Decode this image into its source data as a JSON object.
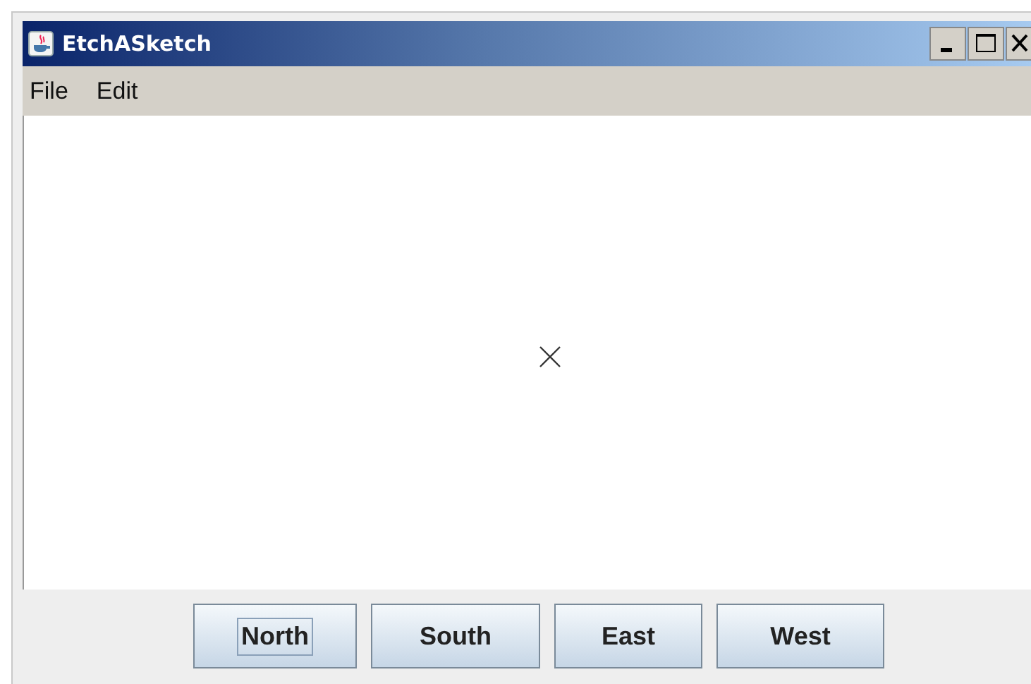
{
  "window": {
    "title": "EtchASketch"
  },
  "menu_bar": [
    "File",
    "Edit"
  ],
  "buttons": [
    {
      "label": "North",
      "focused": true
    },
    {
      "label": "South",
      "focused": false
    },
    {
      "label": "East",
      "focused": false
    },
    {
      "label": "West",
      "focused": false
    }
  ]
}
